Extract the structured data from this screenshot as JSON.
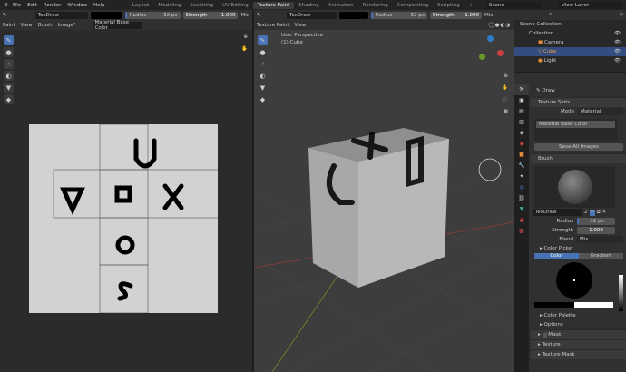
{
  "menu": [
    "File",
    "Edit",
    "Render",
    "Window",
    "Help"
  ],
  "workspaces": [
    "Layout",
    "Modeling",
    "Sculpting",
    "UV Editing",
    "Texture Paint",
    "Shading",
    "Animation",
    "Rendering",
    "Compositing",
    "Scripting",
    "+"
  ],
  "active_workspace": "Texture Paint",
  "scene": "Scene",
  "view_layer": "View Layer",
  "tool_header": {
    "brush": "TexDraw",
    "radius_label": "Radius",
    "radius": "32 px",
    "strength_label": "Strength",
    "strength": "1.000",
    "blend": "Mix"
  },
  "image_editor": {
    "mode": "Paint",
    "menus": [
      "View",
      "Brush",
      "Image*"
    ],
    "image": "Material Base Color"
  },
  "viewport": {
    "mode": "Texture Paint",
    "menus": [
      "View"
    ],
    "perspective": "User Perspective",
    "object": "(1) Cube"
  },
  "outliner": {
    "items": [
      {
        "label": "Scene Collection"
      },
      {
        "label": "Collection"
      },
      {
        "label": "Camera"
      },
      {
        "label": "Cube",
        "selected": true
      },
      {
        "label": "Light"
      }
    ]
  },
  "properties": {
    "tool": "Draw",
    "texture_slots": "Texture Slots",
    "mode_label": "Mode",
    "mode": "Material",
    "slot": "Material Base Color",
    "save_all": "Save All Images",
    "brush_panel": "Brush",
    "brush_name": "TexDraw",
    "users": "2",
    "radius_label": "Radius",
    "radius": "32 px",
    "strength_label": "Strength",
    "strength": "1.000",
    "blend_label": "Blend",
    "blend": "Mix",
    "color_picker": "Color Picker",
    "tab_color": "Color",
    "tab_gradient": "Gradient",
    "color_palette": "Color Palette",
    "options": "Options",
    "mask": "Mask",
    "texture": "Texture",
    "texture_mask": "Texture Mask"
  },
  "colors": {
    "accent": "#4772b3",
    "paint": "#000000"
  }
}
